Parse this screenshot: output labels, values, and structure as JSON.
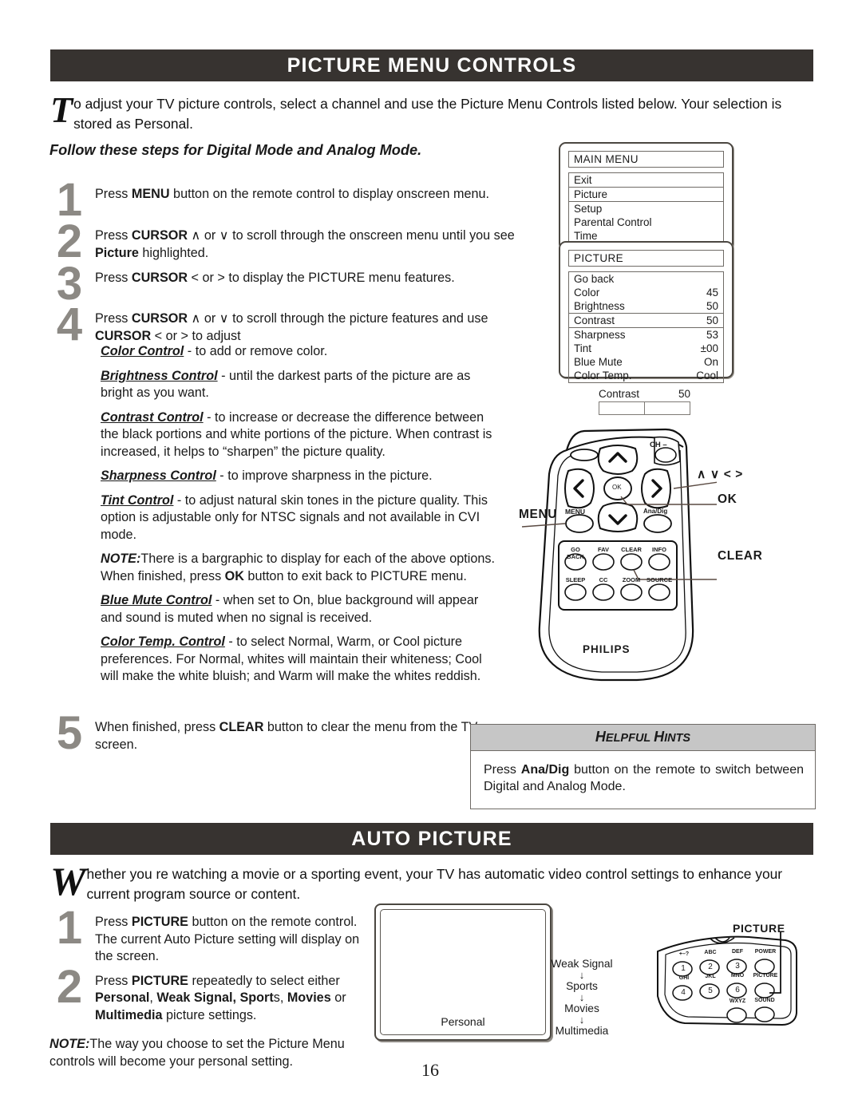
{
  "page": {
    "number": "16"
  },
  "sections": {
    "picture_menu": {
      "title": "PICTURE MENU CONTROLS",
      "intro_cap": "T",
      "intro_text": "o adjust your TV picture controls, select a channel and use the Picture Menu Controls listed below. Your selection is stored as Personal.",
      "subhead": "Follow these steps for Digital Mode and Analog Mode.",
      "steps": [
        {
          "num": "1",
          "text_html": "Press <b>MENU</b> button on the remote control to display onscreen menu."
        },
        {
          "num": "2",
          "text_html": "Press <b>CURSOR</b> ∧ or ∨ to scroll through the onscreen menu until you see <b>Picture</b> highlighted."
        },
        {
          "num": "3",
          "text_html": "Press <b>CURSOR</b> &lt; or &gt; to display the PICTURE menu features."
        },
        {
          "num": "4",
          "text_html": "Press <b>CURSOR</b> ∧ or ∨ to scroll through the picture features and use <b>CURSOR</b> &lt; or &gt; to adjust"
        }
      ],
      "controls": [
        {
          "term": "Color Control",
          "body": " - to add or remove color."
        },
        {
          "term": "Brightness Control",
          "body": " - until the darkest parts of the picture are as bright as you want."
        },
        {
          "term": "Contrast Control",
          "body": " - to increase or decrease the difference between the black portions and white portions of the picture. When contrast is increased, it helps to “sharpen” the picture quality."
        },
        {
          "term": "Sharpness Control",
          "body": " - to improve sharpness in the picture."
        },
        {
          "term": "Tint Control",
          "body": " - to adjust natural skin tones in the picture quality. This option is adjustable only for NTSC signals and not available in CVI mode."
        }
      ],
      "note_label": "NOTE:",
      "note_text": "There is a bargraphic to display for each of the above options. When finished, press ",
      "note_bold": "OK",
      "note_text2": " button to exit back to PICTURE menu.",
      "controls2": [
        {
          "term": "Blue Mute Control",
          "body": " - when set to On, blue background will appear and sound is muted when no signal is received."
        },
        {
          "term": "Color Temp. Control",
          "body": " - to select Normal, Warm, or Cool picture preferences. For Normal, whites will maintain their whiteness; Cool will make the white bluish; and Warm will make the whites reddish."
        }
      ],
      "step5": {
        "num": "5",
        "text_html": "When finished, press <b>CLEAR</b> button to clear the menu from the TV screen."
      }
    },
    "auto_picture": {
      "title": "AUTO PICTURE",
      "intro_cap": "W",
      "intro_text": "hether you re watching a movie or a sporting event, your TV has automatic video control settings to enhance your current program source or content.",
      "steps": [
        {
          "num": "1",
          "text_html": "Press <b>PICTURE</b> button on the remote control. The current Auto Picture setting will display on the screen."
        },
        {
          "num": "2",
          "text_html": "Press <b>PICTURE</b> repeatedly to select either <b>Personal</b>, <b>Weak Signal, Sport</b>s, <b>Movies</b> or <b>Multimedia</b> picture settings."
        }
      ],
      "note_label": "NOTE:",
      "note_text": "The way you choose to set the Picture Menu controls will become your personal setting.",
      "tv_label": "Personal",
      "flow": [
        "Weak Signal",
        "Sports",
        "Movies",
        "Multimedia"
      ],
      "keypad_callout": "PICTURE"
    }
  },
  "osd": {
    "main_menu": {
      "title": "MAIN MENU",
      "items": [
        {
          "label": "Exit",
          "value": "",
          "highlighted": false
        },
        {
          "label": "Picture",
          "value": "",
          "highlighted": true
        },
        {
          "label": "Setup",
          "value": "",
          "highlighted": false
        },
        {
          "label": "Parental Control",
          "value": "",
          "highlighted": false
        },
        {
          "label": "Time",
          "value": "",
          "highlighted": false
        }
      ]
    },
    "picture_menu": {
      "title": "PICTURE",
      "items": [
        {
          "label": "Go back",
          "value": "",
          "highlighted": false
        },
        {
          "label": "Color",
          "value": "45",
          "highlighted": false
        },
        {
          "label": "Brightness",
          "value": "50",
          "highlighted": false
        },
        {
          "label": "Contrast",
          "value": "50",
          "highlighted": true
        },
        {
          "label": "Sharpness",
          "value": "53",
          "highlighted": false
        },
        {
          "label": "Tint",
          "value": "±00",
          "highlighted": false
        },
        {
          "label": "Blue Mute",
          "value": "On",
          "highlighted": false
        },
        {
          "label": "Color Temp.",
          "value": "Cool",
          "highlighted": false
        }
      ]
    },
    "bargraph": {
      "label": "Contrast",
      "value": "50",
      "fill_percent": 50
    }
  },
  "remote": {
    "brand": "PHILIPS",
    "buttons": {
      "ch_minus": "CH –",
      "ok": "OK",
      "menu": "MENU",
      "anadig": "Ana/Dig",
      "row1": [
        "GO BACK",
        "FAV",
        "CLEAR",
        "INFO"
      ],
      "row2": [
        "SLEEP",
        "CC",
        "ZOOM",
        "SOURCE"
      ]
    },
    "callouts": {
      "cursor": "∧ ∨ < >",
      "ok": "OK",
      "menu": "MENU",
      "clear": "CLEAR"
    }
  },
  "keypad": {
    "keys": [
      {
        "sub": "+–?",
        "num": "1"
      },
      {
        "sub": "ABC",
        "num": "2"
      },
      {
        "sub": "DEF",
        "num": "3"
      },
      {
        "sub": "POWER",
        "num": ""
      },
      {
        "sub": "GHI",
        "num": "4"
      },
      {
        "sub": "JKL",
        "num": "5"
      },
      {
        "sub": "MNO",
        "num": "6"
      },
      {
        "sub": "PICTURE",
        "num": ""
      }
    ],
    "row3": [
      "WXYZ",
      "SOUND"
    ]
  },
  "hints": {
    "title_a": "H",
    "title_b": "ELPFUL ",
    "title_c": "H",
    "title_d": "INTS",
    "body_pre": "Press ",
    "body_bold": "Ana/Dig",
    "body_post": " button on the remote to switch between Digital and Analog Mode."
  },
  "colors": {
    "band": "#373330",
    "stepnum": "#8c8984",
    "hints_header": "#c6c6c6"
  }
}
